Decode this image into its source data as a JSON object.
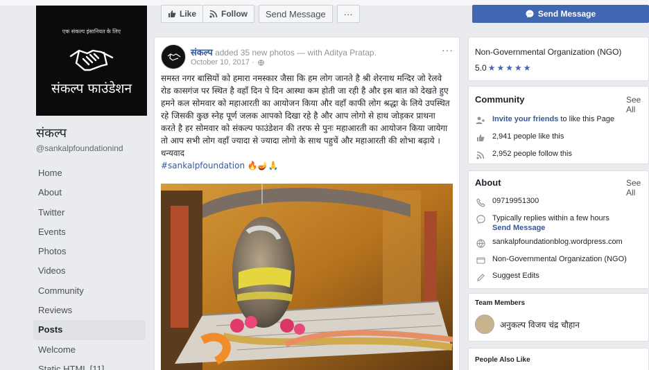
{
  "sidebar": {
    "logo_tagline": "एक संकल्प इंसानियत के लिए",
    "logo_name": "संकल्प फाउंडेशन",
    "page_name": "संकल्प",
    "page_handle": "@sankalpfoundationind",
    "nav": [
      {
        "label": "Home"
      },
      {
        "label": "About"
      },
      {
        "label": "Twitter"
      },
      {
        "label": "Events"
      },
      {
        "label": "Photos"
      },
      {
        "label": "Videos"
      },
      {
        "label": "Community"
      },
      {
        "label": "Reviews"
      },
      {
        "label": "Posts"
      },
      {
        "label": "Welcome"
      },
      {
        "label": "Static HTML [11]"
      }
    ],
    "active_item": "Posts"
  },
  "actions": {
    "like": "Like",
    "follow": "Follow",
    "send_message": "Send Message",
    "more": "···"
  },
  "post": {
    "author": "संकल्प",
    "action": "added 35 new photos — with",
    "tagged": "Aditya Pratap.",
    "date": "October 10, 2017 ·",
    "menu": "···",
    "body": "समस्त नगर बासियों को हमारा नमस्कार जैसा कि हम लोग जानते है श्री शेरनाथ मन्दिर जो रेलवे रोड कासगंज पर स्थित है वहाँ दिन पे दिन आस्था कम होती जा रही है और इस बात को देखते हुए हमने कल सोमवार को महाआरती का आयोजन किया और वहाँ काफी लोग श्रद्धा के लिये उपस्थित रहे जिसकी कुछ स्नेह पूर्ण जलक आपको दिखा रहे है और आप लोगो से हाथ जोड़कर प्राथना करते है हर सोमवार को संकल्प फाउंडेशन की तरफ से पुनः महाआरती का आयोजन किया जायेगा तो आप सभी लोग वहाँ ज्यादा से ज्यादा लोगो के साथ पहुचें और महाआरती की शोभा बढ़ाये ।",
    "signoff": "धन्यवाद",
    "hashtag": "#sankalpfoundation",
    "emoji": "🔥🪔🙏"
  },
  "right": {
    "send_message": "Send Message",
    "category": "Non-Governmental Organization (NGO)",
    "rating": "5.0",
    "stars": 5,
    "community": {
      "title": "Community",
      "see_all": "See All",
      "invite_link": "Invite your friends",
      "invite_rest": "to like this Page",
      "likes": "2,941 people like this",
      "follows": "2,952 people follow this"
    },
    "about": {
      "title": "About",
      "see_all": "See All",
      "phone": "09719951300",
      "replies": "Typically replies within a few hours",
      "send_message": "Send Message",
      "website": "sankalpfoundationblog.wordpress.com",
      "category": "Non-Governmental Organization (NGO)",
      "suggest": "Suggest Edits"
    },
    "team": {
      "title": "Team Members",
      "member": "अनुकल्प विजय चंद्र चौहान"
    },
    "people_also_like": "People Also Like"
  },
  "colors": {
    "brand_blue": "#4267b2",
    "link_blue": "#365899",
    "background": "#e9ebee"
  }
}
